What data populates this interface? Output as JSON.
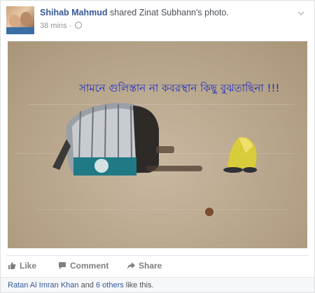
{
  "post": {
    "actor_name": "Shihab Mahmud",
    "action_text": " shared ",
    "source_name": "Zinat Subhann's",
    "source_suffix": " photo.",
    "time": "38 mins",
    "separator": " · ",
    "privacy_icon": "globe-icon",
    "menu_icon": "chevron-down-icon"
  },
  "photo": {
    "caption": "সামনে গুলিস্তান না কবরস্থান কিছু  বুঝতাছিনা !!!"
  },
  "actions": {
    "like_label": "Like",
    "comment_label": "Comment",
    "share_label": "Share"
  },
  "reactions": {
    "first_name": "Ratan Al Imran Khan",
    "and_text": " and ",
    "others_text": "6 others",
    "suffix_text": " like this."
  },
  "colors": {
    "link": "#365899",
    "caption": "#1d2cc4",
    "muted": "#90949c"
  }
}
